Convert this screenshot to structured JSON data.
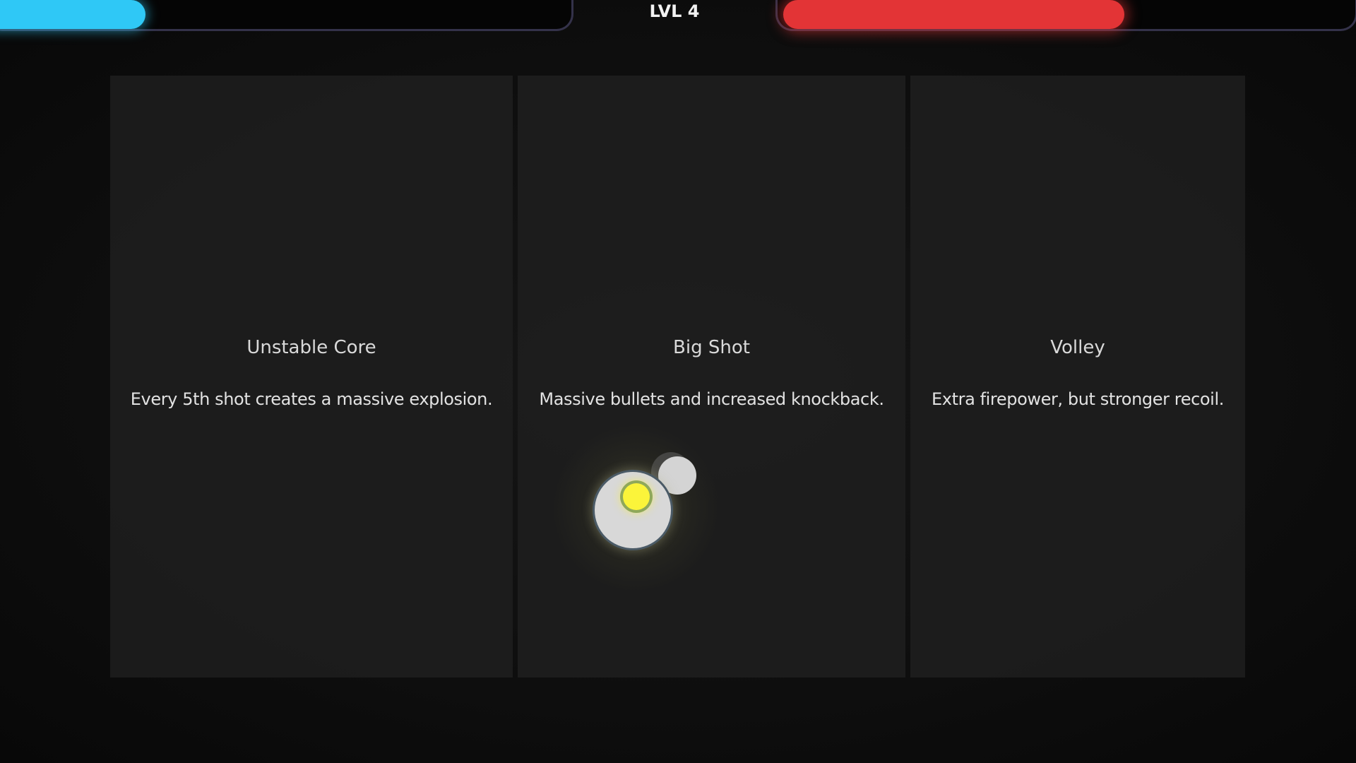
{
  "hud": {
    "level_label": "LVL 4",
    "xp_fraction": 0.27,
    "health_fraction": 0.59,
    "xp_color": "#2fc8f6",
    "health_color": "#e33436"
  },
  "upgrades": [
    {
      "title": "Unstable Core",
      "description": "Every 5th shot creates a massive explosion."
    },
    {
      "title": "Big Shot",
      "description": "Massive bullets and increased knockback."
    },
    {
      "title": "Volley",
      "description": "Extra firepower, but stronger recoil."
    }
  ],
  "player": {
    "icon": "player-sprite",
    "core_color": "#fbf43a"
  }
}
